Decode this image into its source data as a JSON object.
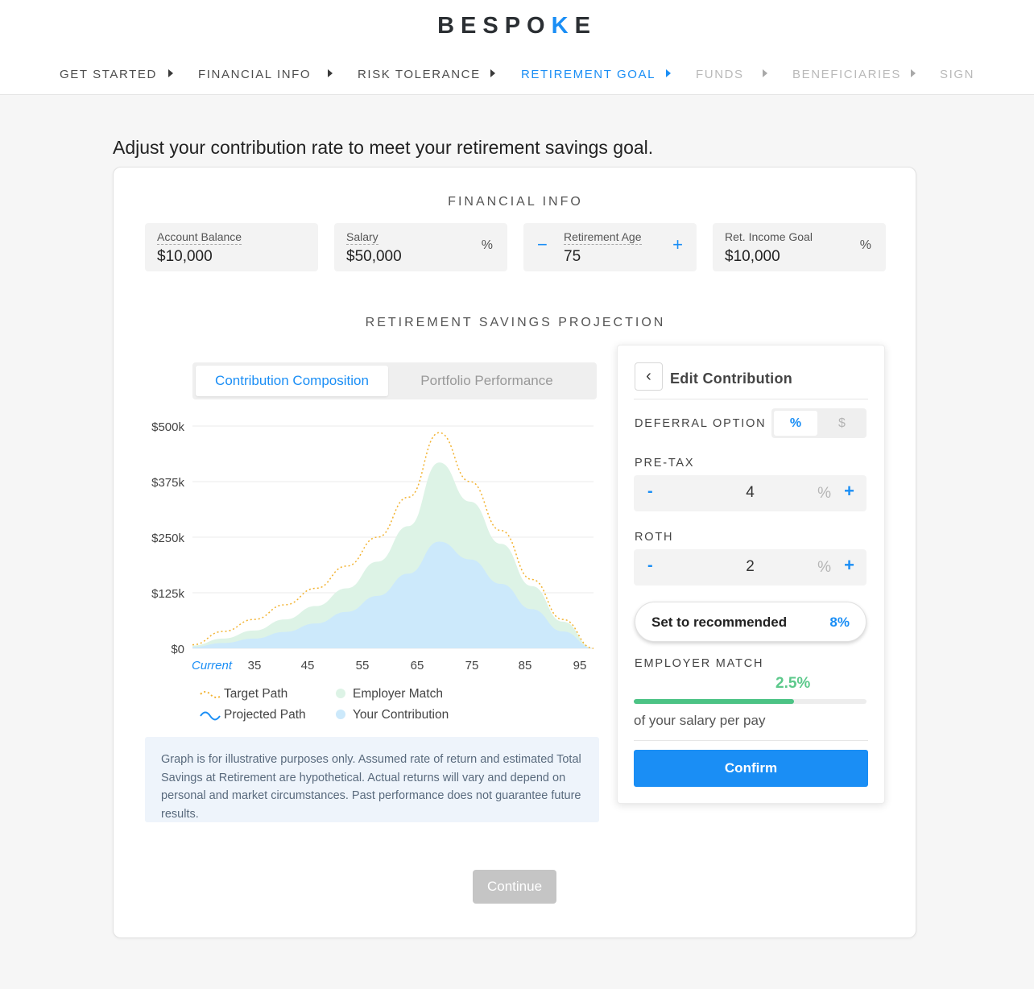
{
  "brand": {
    "logo_left": "BESPO",
    "logo_accent": "K",
    "logo_right": "E"
  },
  "steps": [
    {
      "label": "GET STARTED",
      "state": "done"
    },
    {
      "label": "FINANCIAL INFO",
      "state": "done"
    },
    {
      "label": "RISK TOLERANCE",
      "state": "done"
    },
    {
      "label": "RETIREMENT GOAL",
      "state": "active"
    },
    {
      "label": "FUNDS",
      "state": "future"
    },
    {
      "label": "BENEFICIARIES",
      "state": "future"
    },
    {
      "label": "SIGN",
      "state": "future"
    }
  ],
  "headline": "Adjust your contribution rate to meet your retirement savings goal.",
  "financial_info": {
    "title": "FINANCIAL INFO",
    "account_balance": {
      "label": "Account Balance",
      "value": "$10,000"
    },
    "salary": {
      "label": "Salary",
      "value": "$50,000",
      "unit": "%"
    },
    "retirement_age": {
      "label": "Retirement Age",
      "value": "75",
      "minus": "−",
      "plus": "+"
    },
    "income_goal": {
      "label": "Ret. Income Goal",
      "value": "$10,000",
      "unit": "%"
    }
  },
  "projection": {
    "title": "RETIREMENT SAVINGS PROJECTION",
    "tabs": [
      "Contribution Composition",
      "Portfolio Performance"
    ],
    "active_tab": 0
  },
  "chart_data": {
    "type": "area",
    "x": [
      30,
      35,
      40,
      45,
      50,
      55,
      60,
      65,
      70,
      75,
      80,
      85,
      90,
      95
    ],
    "x_tick_labels": [
      "Current",
      "35",
      "45",
      "55",
      "65",
      "75",
      "85",
      "95"
    ],
    "y_tick_labels": [
      "$500k",
      "$375k",
      "$250k",
      "$125k",
      "$0"
    ],
    "ylim": [
      0,
      500000
    ],
    "grid": true,
    "legend_position": "bottom-left",
    "series": [
      {
        "name": "Target Path",
        "style": "dotted-line",
        "color": "#f2b230",
        "values": [
          8000,
          38000,
          65000,
          98000,
          135000,
          185000,
          250000,
          340000,
          485000,
          375000,
          265000,
          155000,
          65000,
          0
        ]
      },
      {
        "name": "Projected Path",
        "style": "line",
        "color": "#1a8ef5",
        "values": []
      },
      {
        "name": "Employer Match",
        "style": "area",
        "color": "#ddf3e6",
        "values": [
          6000,
          22000,
          40000,
          65000,
          95000,
          135000,
          195000,
          275000,
          418000,
          330000,
          235000,
          140000,
          60000,
          0
        ]
      },
      {
        "name": "Your Contribution",
        "style": "area",
        "color": "#cce9fb",
        "values": [
          3000,
          12000,
          22000,
          37000,
          56000,
          82000,
          118000,
          168000,
          240000,
          200000,
          145000,
          88000,
          38000,
          0
        ]
      }
    ]
  },
  "disclaimer": "Graph is for illustrative purposes only. Assumed rate of return and estimated Total Savings at Retirement are hypothetical. Actual returns will vary and depend on personal and market circumstances. Past performance does not guarantee future results.",
  "continue_label": "Continue",
  "edit_panel": {
    "back_icon": "‹",
    "title": "Edit Contribution",
    "deferral_label": "DEFERRAL OPTION",
    "deferral_options": [
      "%",
      "$"
    ],
    "pretax": {
      "label": "PRE-TAX",
      "value": "4",
      "unit": "%",
      "minus": "-",
      "plus": "+"
    },
    "roth": {
      "label": "ROTH",
      "value": "2",
      "unit": "%",
      "minus": "-",
      "plus": "+"
    },
    "recommended": {
      "label": "Set to recommended",
      "value": "8%"
    },
    "employer_match": {
      "label": "EMPLOYER MATCH",
      "value": "2.5%",
      "fill_fraction": 0.69,
      "note": "of your salary per pay"
    },
    "confirm_label": "Confirm"
  }
}
